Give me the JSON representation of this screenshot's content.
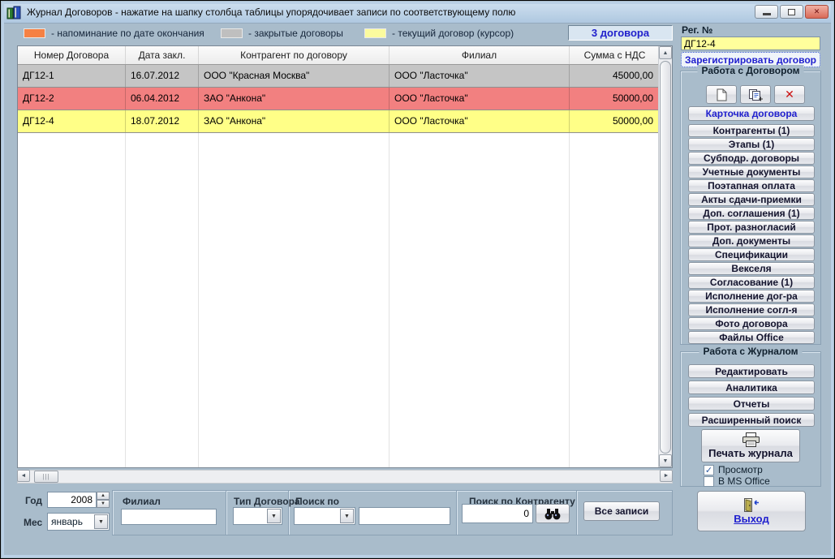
{
  "window": {
    "title": "Журнал Договоров - нажатие на шапку столбца таблицы упорядочивает записи по соответствующему полю"
  },
  "legend": {
    "items": [
      {
        "label": "- напоминание по дате окончания",
        "color": "#F58144"
      },
      {
        "label": "- закрытые договоры",
        "color": "#BFBFBF"
      },
      {
        "label": "- текущий договор (курсор)",
        "color": "#FBFB9E"
      }
    ],
    "count_label": "3 договора"
  },
  "table": {
    "columns": [
      "Номер Договора",
      "Дата закл.",
      "Контрагент по договору",
      "Филиал",
      "Сумма с НДС"
    ],
    "rows": [
      {
        "number": "ДГ12-1",
        "date": "16.07.2012",
        "counterparty": "ООО \"Красная Москва\"",
        "branch": "ООО \"Ласточка\"",
        "amount": "45000,00",
        "color": "#C5C5C5",
        "state": "закрытый договор"
      },
      {
        "number": "ДГ12-2",
        "date": "06.04.2012",
        "counterparty": "ЗАО \"Анкона\"",
        "branch": "ООО \"Ласточка\"",
        "amount": "50000,00",
        "color": "#F28080",
        "state": "напоминание по дате окончания"
      },
      {
        "number": "ДГ12-4",
        "date": "18.07.2012",
        "counterparty": "ЗАО \"Анкона\"",
        "branch": "ООО \"Ласточка\"",
        "amount": "50000,00",
        "color": "#FFFF87",
        "state": "текущий договор"
      }
    ]
  },
  "filters": {
    "year": {
      "label": "Год",
      "value": "2008"
    },
    "month": {
      "label": "Мес",
      "value": "январь"
    },
    "branch": {
      "label": "Филиал",
      "value": ""
    },
    "contract_type": {
      "label": "Тип Договора",
      "value": ""
    },
    "search_by": {
      "label": "Поиск по",
      "value": "",
      "query": ""
    },
    "search_counterparty": {
      "label": "Поиск по Контрагенту",
      "value": "0"
    },
    "all_records_label": "Все записи"
  },
  "sidebar": {
    "reg": {
      "label": "Рег. №",
      "value": "ДГ12-4"
    },
    "register_button": "Зарегистрировать договор",
    "contract_group": {
      "title": "Работа с Договором",
      "card_button": "Карточка договора",
      "buttons": [
        "Контрагенты (1)",
        "Этапы (1)",
        "Субподр. договоры",
        "Учетные документы",
        "Поэтапная оплата",
        "Акты сдачи-приемки",
        "Доп. соглашения (1)",
        "Прот. разногласий",
        "Доп. документы",
        "Спецификации",
        "Векселя",
        "Согласование (1)",
        "Исполнение дог-ра",
        "Исполнение согл-я",
        "Фото договора",
        "Файлы Office"
      ]
    },
    "journal_group": {
      "title": "Работа с Журналом",
      "buttons": [
        "Редактировать",
        "Аналитика",
        "Отчеты",
        "Расширенный поиск"
      ],
      "print_button": "Печать журнала",
      "checkboxes": [
        {
          "label": "Просмотр",
          "checked": true
        },
        {
          "label": "В MS Office",
          "checked": false
        }
      ]
    },
    "exit_button": "Выход"
  }
}
